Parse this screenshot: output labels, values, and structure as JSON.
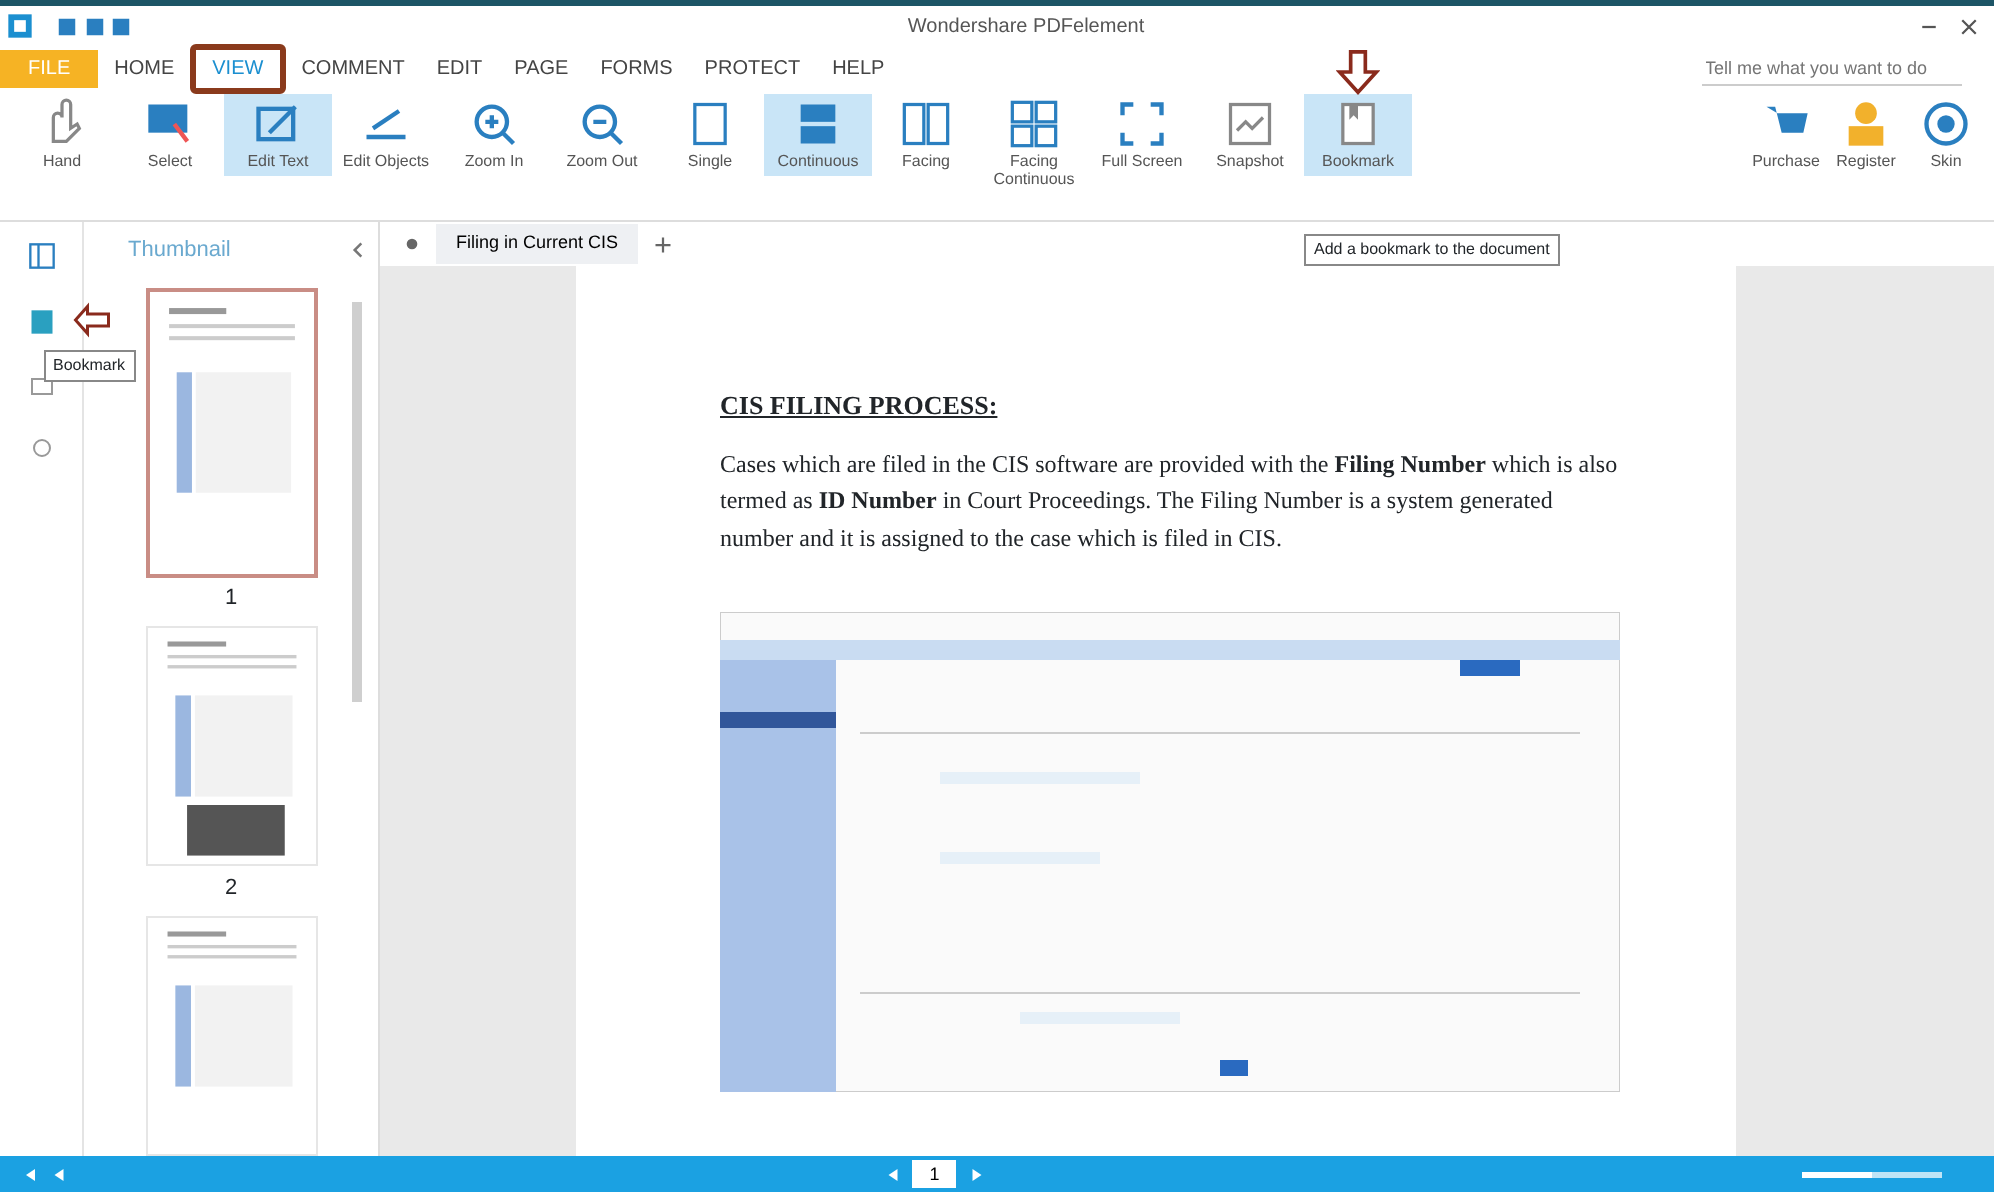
{
  "window": {
    "title": "Wondershare PDFelement"
  },
  "menu": [
    {
      "label": "FILE",
      "kind": "file",
      "selected": false
    },
    {
      "label": "HOME",
      "kind": "tab",
      "selected": false
    },
    {
      "label": "VIEW",
      "kind": "tab",
      "selected": true
    },
    {
      "label": "COMMENT",
      "kind": "tab",
      "selected": false
    },
    {
      "label": "EDIT",
      "kind": "tab",
      "selected": false
    },
    {
      "label": "PAGE",
      "kind": "tab",
      "selected": false
    },
    {
      "label": "FORMS",
      "kind": "tab",
      "selected": false
    },
    {
      "label": "PROTECT",
      "kind": "tab",
      "selected": false
    },
    {
      "label": "HELP",
      "kind": "tab",
      "selected": false
    }
  ],
  "search": {
    "placeholder": "Tell me what you want to do"
  },
  "ribbon": [
    {
      "label": "Hand",
      "selected": false
    },
    {
      "label": "Select",
      "selected": false
    },
    {
      "label": "Edit Text",
      "selected": true
    },
    {
      "label": "Edit Objects",
      "selected": false
    },
    {
      "label": "Zoom In",
      "selected": false
    },
    {
      "label": "Zoom Out",
      "selected": false
    },
    {
      "label": "Single",
      "selected": false
    },
    {
      "label": "Continuous",
      "selected": true
    },
    {
      "label": "Facing",
      "selected": false
    },
    {
      "label": "Facing Continuous",
      "selected": false
    },
    {
      "label": "Full Screen",
      "selected": false
    },
    {
      "label": "Snapshot",
      "selected": false
    },
    {
      "label": "Bookmark",
      "selected": true
    }
  ],
  "ribbon_right": [
    {
      "label": "Purchase"
    },
    {
      "label": "Register"
    },
    {
      "label": "Skin"
    }
  ],
  "tooltips": {
    "ribbon": "Add a bookmark to the document",
    "sidebar": "Bookmark"
  },
  "sidebar": {
    "title": "Thumbnail",
    "thumbnails": [
      {
        "number": "1",
        "selected": true
      },
      {
        "number": "2",
        "selected": false
      },
      {
        "selected": false
      }
    ]
  },
  "document_tab": {
    "label": "Filing in Current CIS"
  },
  "page": {
    "heading": "CIS FILING PROCESS:",
    "paragraph": "Cases which are filed in the CIS software are provided with the **Filing Number** which is also termed as **ID Number** in Court Proceedings. The Filing Number is a system generated number and it is assigned to the case which is filed in CIS."
  },
  "status_bar": {
    "page": "1",
    "zoom": {
      "level": 0.5
    }
  }
}
